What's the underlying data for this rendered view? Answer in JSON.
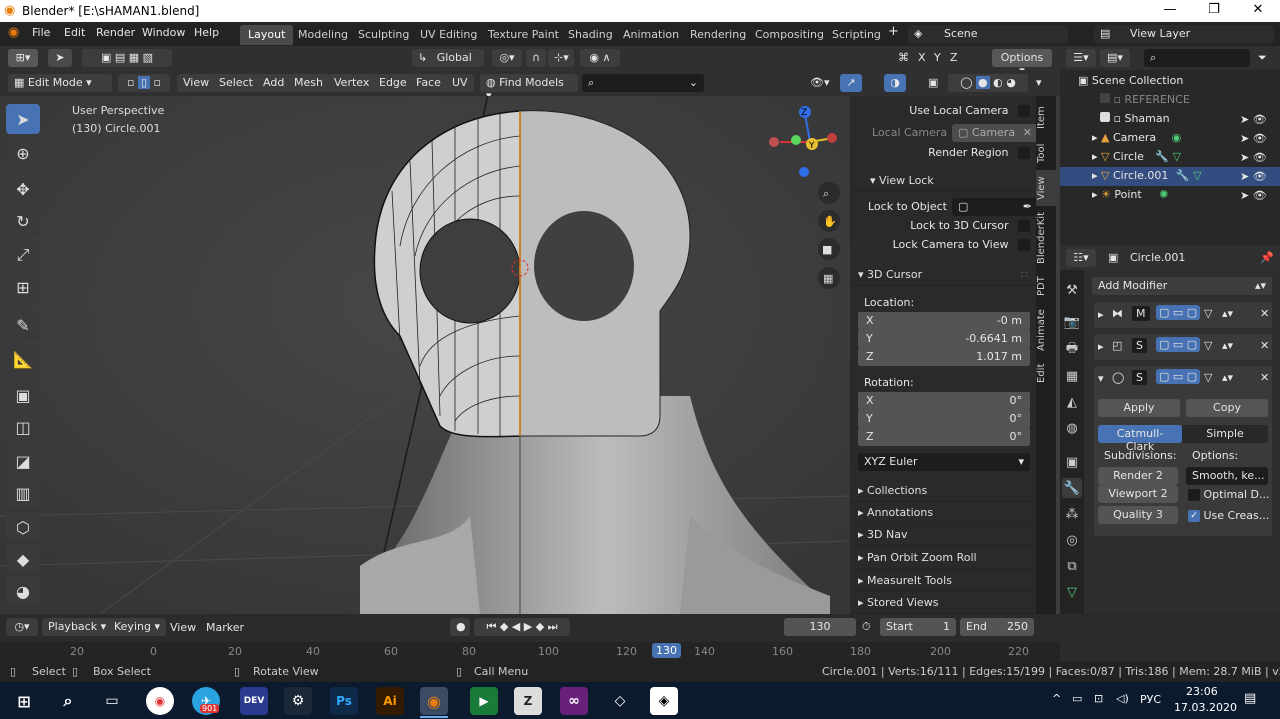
{
  "window": {
    "title": "Blender* [E:\\sHAMAN1.blend]"
  },
  "menu": [
    "File",
    "Edit",
    "Render",
    "Window",
    "Help"
  ],
  "workspaces": [
    "Layout",
    "Modeling",
    "Sculpting",
    "UV Editing",
    "Texture Paint",
    "Shading",
    "Animation",
    "Rendering",
    "Compositing",
    "Scripting"
  ],
  "scene": {
    "label": "Scene",
    "view_layer": "View Layer"
  },
  "header": {
    "transform": "Global",
    "options": "Options",
    "mode": "Edit Mode",
    "menus": [
      "View",
      "Select",
      "Add",
      "Mesh",
      "Vertex",
      "Edge",
      "Face",
      "UV"
    ],
    "find_models": "Find Models",
    "axes": [
      "X",
      "Y",
      "Z"
    ]
  },
  "viewport": {
    "perspective": "User Perspective",
    "object": "(130) Circle.001",
    "gizmo": {
      "z": "Z",
      "y": "Y"
    }
  },
  "npanel": {
    "tabs": [
      "Item",
      "Tool",
      "View",
      "BlenderKit",
      "PDT",
      "Animate",
      "Edit"
    ],
    "use_local_camera": "Use Local Camera",
    "local_camera": "Local Camera",
    "camera": "Camera",
    "render_region": "Render Region",
    "view_lock": "View Lock",
    "lock_to_object": "Lock to Object",
    "lock_to_cursor": "Lock to 3D Cursor",
    "lock_camera": "Lock Camera to View",
    "cursor_title": "3D Cursor",
    "location": "Location:",
    "loc": [
      {
        "axis": "X",
        "value": "-0 m"
      },
      {
        "axis": "Y",
        "value": "-0.6641 m"
      },
      {
        "axis": "Z",
        "value": "1.017 m"
      }
    ],
    "rotation": "Rotation:",
    "rot": [
      {
        "axis": "X",
        "value": "0°"
      },
      {
        "axis": "Y",
        "value": "0°"
      },
      {
        "axis": "Z",
        "value": "0°"
      }
    ],
    "euler": "XYZ Euler",
    "sections": [
      "Collections",
      "Annotations",
      "3D Nav",
      "Pan Orbit Zoom Roll",
      "MeasureIt Tools",
      "Stored Views"
    ]
  },
  "outliner": {
    "root": "Scene Collection",
    "items": [
      {
        "name": "REFERENCE"
      },
      {
        "name": "Shaman"
      },
      {
        "name": "Camera"
      },
      {
        "name": "Circle"
      },
      {
        "name": "Circle.001"
      },
      {
        "name": "Point"
      }
    ]
  },
  "properties": {
    "object": "Circle.001",
    "add_modifier": "Add Modifier",
    "mod_letters": [
      "M",
      "S",
      "S"
    ],
    "apply": "Apply",
    "copy": "Copy",
    "catmull": "Catmull-Clark",
    "simple": "Simple",
    "subdivisions": "Subdivisions:",
    "options": "Options:",
    "render": "Render",
    "render_val": "2",
    "viewport": "Viewport",
    "viewport_val": "2",
    "quality": "Quality",
    "quality_val": "3",
    "smooth": "Smooth, ke...",
    "optimal": "Optimal D...",
    "use_crease": "Use Creas..."
  },
  "timeline": {
    "playback": "Playback",
    "keying": "Keying",
    "view": "View",
    "marker": "Marker",
    "frame": "130",
    "start_label": "Start",
    "start": "1",
    "end_label": "End",
    "end": "250",
    "ticks": [
      "20",
      "0",
      "20",
      "40",
      "60",
      "80",
      "100",
      "120",
      "130",
      "140",
      "160",
      "180",
      "200",
      "220"
    ]
  },
  "status": {
    "select": "Select",
    "box_select": "Box Select",
    "rotate": "Rotate View",
    "call_menu": "Call Menu",
    "stats": "Circle.001 | Verts:16/111 | Edges:15/199 | Faces:0/87 | Tris:186 | Mem: 28.7 MiB | v2.82.7"
  },
  "taskbar": {
    "lang": "РУС",
    "time": "23:06",
    "date": "17.03.2020",
    "badge": "901",
    "icons": [
      "DEV",
      "Ps",
      "Ai"
    ]
  },
  "colors": {
    "accent": "#4772b3",
    "selected_row": "#334d80",
    "blender_orange": "#e87d0d"
  }
}
